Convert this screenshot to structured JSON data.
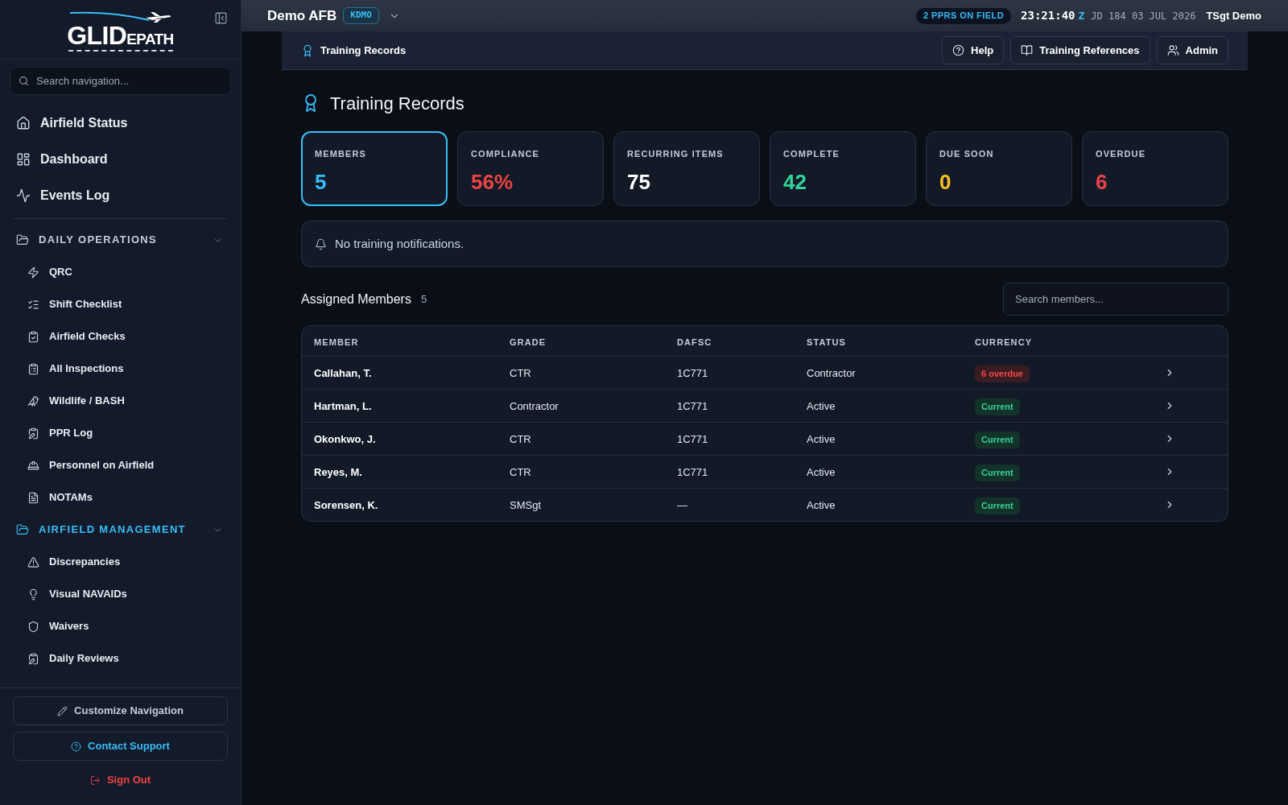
{
  "sidebar": {
    "logo": "GLIDEPATH",
    "search": {
      "placeholder": "Search navigation..."
    },
    "top_items": [
      {
        "label": "Airfield Status"
      },
      {
        "label": "Dashboard"
      },
      {
        "label": "Events Log"
      }
    ],
    "sections": [
      {
        "label": "DAILY OPERATIONS",
        "active": false,
        "expanded": true,
        "items": [
          {
            "label": "QRC"
          },
          {
            "label": "Shift Checklist"
          },
          {
            "label": "Airfield Checks"
          },
          {
            "label": "All Inspections"
          },
          {
            "label": "Wildlife / BASH"
          },
          {
            "label": "PPR Log"
          },
          {
            "label": "Personnel on Airfield"
          },
          {
            "label": "NOTAMs"
          }
        ]
      },
      {
        "label": "AIRFIELD MANAGEMENT",
        "active": true,
        "expanded": true,
        "items": [
          {
            "label": "Discrepancies"
          },
          {
            "label": "Visual NAVAIDs"
          },
          {
            "label": "Waivers"
          },
          {
            "label": "Daily Reviews"
          }
        ]
      }
    ],
    "footer": {
      "customize": "Customize Navigation",
      "support": "Contact Support",
      "sign_out": "Sign Out"
    }
  },
  "topbar": {
    "base": "Demo AFB",
    "icao": "KDMO",
    "ppr_badge": "2 PPRS ON FIELD",
    "time": "23:21:40",
    "zone": "Z",
    "date": "JD 184 03 JUL 2026",
    "user": "TSgt Demo"
  },
  "subheader": {
    "title": "Training Records",
    "buttons": [
      "Help",
      "Training References",
      "Admin"
    ]
  },
  "page": {
    "title": "Training Records",
    "stats": [
      {
        "label": "MEMBERS",
        "value": "5",
        "color": "#38bdf8",
        "selected": true
      },
      {
        "label": "COMPLIANCE",
        "value": "56%",
        "color": "#ef4444",
        "selected": false
      },
      {
        "label": "RECURRING ITEMS",
        "value": "75",
        "color": "#ffffff",
        "selected": false
      },
      {
        "label": "COMPLETE",
        "value": "42",
        "color": "#34d399",
        "selected": false
      },
      {
        "label": "DUE SOON",
        "value": "0",
        "color": "#fbbf24",
        "selected": false
      },
      {
        "label": "OVERDUE",
        "value": "6",
        "color": "#ef4444",
        "selected": false
      }
    ],
    "notification": "No training notifications.",
    "members": {
      "title": "Assigned Members",
      "count": "5",
      "search": {
        "placeholder": "Search members..."
      }
    },
    "table": {
      "columns": [
        "MEMBER",
        "GRADE",
        "DAFSC",
        "STATUS",
        "CURRENCY"
      ],
      "rows": [
        {
          "member": "Callahan, T.",
          "grade": "CTR",
          "dafsc": "1C771",
          "status": "Contractor",
          "currency": {
            "label": "6 overdue",
            "kind": "overdue"
          }
        },
        {
          "member": "Hartman, L.",
          "grade": "Contractor",
          "dafsc": "1C771",
          "status": "Active",
          "currency": {
            "label": "Current",
            "kind": "current"
          }
        },
        {
          "member": "Okonkwo, J.",
          "grade": "CTR",
          "dafsc": "1C771",
          "status": "Active",
          "currency": {
            "label": "Current",
            "kind": "current"
          }
        },
        {
          "member": "Reyes, M.",
          "grade": "CTR",
          "dafsc": "1C771",
          "status": "Active",
          "currency": {
            "label": "Current",
            "kind": "current"
          }
        },
        {
          "member": "Sorensen, K.",
          "grade": "SMSgt",
          "dafsc": "—",
          "status": "Active",
          "currency": {
            "label": "Current",
            "kind": "current"
          }
        }
      ]
    }
  }
}
